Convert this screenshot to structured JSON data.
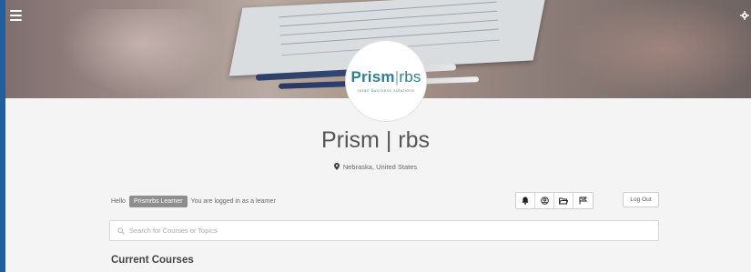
{
  "header": {
    "logo_main": "Prism",
    "logo_separator": "|",
    "logo_secondary": "rbs",
    "logo_tagline": "retail business solutions"
  },
  "profile": {
    "title": "Prism | rbs",
    "location": "Nebraska, United States"
  },
  "greeting": {
    "hello": "Hello",
    "user_name": "Prismrbs Learner",
    "status": "You are logged in as a learner"
  },
  "toolbar": {
    "icons": [
      "bell-icon",
      "user-circle-icon",
      "folder-icon",
      "flag-icon"
    ],
    "logout_label": "Log Out"
  },
  "search": {
    "placeholder": "Search for Courses or Topics",
    "value": ""
  },
  "sections": {
    "current_courses": "Current Courses"
  },
  "colors": {
    "frame_accent": "#1f5f9f",
    "logo_teal": "#2d7f8f",
    "badge_gray": "#8e8e8e"
  }
}
